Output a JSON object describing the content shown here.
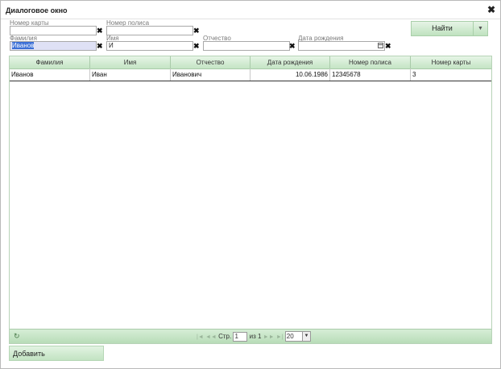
{
  "dialog": {
    "title": "Диалоговое окно",
    "close_icon": "✖"
  },
  "filters": {
    "card_label": "Номер карты",
    "card_value": "",
    "policy_label": "Номер полиса",
    "policy_value": "",
    "surname_label": "Фамилия",
    "surname_value": "Иванов",
    "name_label": "Имя",
    "name_value": "И",
    "patronymic_label": "Отчество",
    "patronymic_value": "",
    "dob_label": "Дата рождения",
    "dob_value": "",
    "clear_icon": "✖"
  },
  "buttons": {
    "find": "Найти",
    "find_dropdown": "▼",
    "add": "Добавить"
  },
  "grid": {
    "columns": [
      "Фамилия",
      "Имя",
      "Отчество",
      "Дата рождения",
      "Номер полиса",
      "Номер карты"
    ],
    "rows": [
      [
        "Иванов",
        "Иван",
        "Иванович",
        "10.06.1986",
        "12345678",
        "3"
      ]
    ]
  },
  "pager": {
    "refresh_icon": "↻",
    "first_icon": "|◄",
    "prev_icon": "◄◄",
    "page_label": "Стр.",
    "page_value": "1",
    "of_label": "из 1",
    "next_icon": "►►",
    "last_icon": "►|",
    "page_size": "20",
    "page_size_arrow": "▼"
  },
  "colors": {
    "accent_green": "#c4e4c4",
    "selection_blue": "#3b6fd6"
  }
}
